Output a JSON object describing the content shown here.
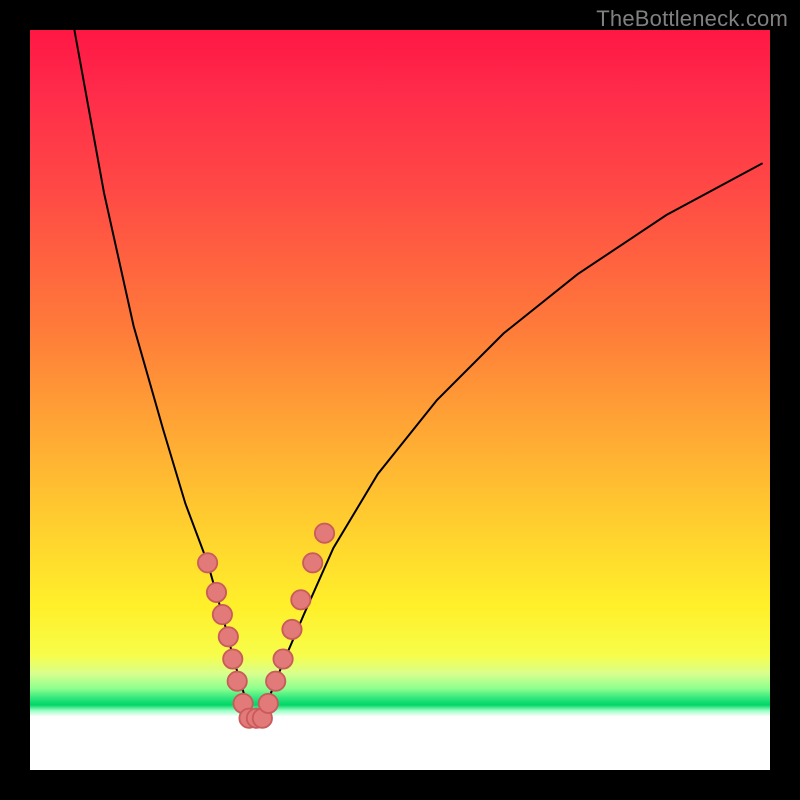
{
  "watermark": "TheBottleneck.com",
  "colors": {
    "gradient_top": "#ff1744",
    "gradient_mid1": "#ff7a3a",
    "gradient_mid2": "#ffd22e",
    "gradient_green": "#00d664",
    "gradient_bottom": "#ffffff",
    "curve_stroke": "#000000",
    "marker_fill": "#e27a7a",
    "marker_stroke": "#c95b5b",
    "frame": "#000000"
  },
  "chart_data": {
    "type": "line",
    "title": "",
    "xlabel": "",
    "ylabel": "",
    "xlim": [
      0,
      100
    ],
    "ylim": [
      0,
      100
    ],
    "note": "No axis ticks, labels, or grid shown. Values describe the V-shaped curve on a 0–100 abstract scale (0 at top, 100 at bottom is inverted for plotting).",
    "series": [
      {
        "name": "bottleneck-curve",
        "x": [
          6,
          10,
          14,
          18,
          21,
          24,
          26,
          27.5,
          29,
          30.5,
          32,
          34,
          37,
          41,
          47,
          55,
          64,
          74,
          86,
          99
        ],
        "y": [
          0,
          22,
          40,
          54,
          64,
          72,
          79,
          85,
          90,
          93,
          91,
          86,
          79,
          70,
          60,
          50,
          41,
          33,
          25,
          18
        ]
      }
    ],
    "markers": {
      "name": "data-points",
      "note": "Salmon circular markers clustered on both arms of the V between roughly y=70 and y=95 (lower portion of chart).",
      "points": [
        {
          "x": 24.0,
          "y": 72
        },
        {
          "x": 25.2,
          "y": 76
        },
        {
          "x": 26.0,
          "y": 79
        },
        {
          "x": 26.8,
          "y": 82
        },
        {
          "x": 27.4,
          "y": 85
        },
        {
          "x": 28.0,
          "y": 88
        },
        {
          "x": 28.8,
          "y": 91
        },
        {
          "x": 29.6,
          "y": 93
        },
        {
          "x": 30.6,
          "y": 93
        },
        {
          "x": 31.4,
          "y": 93
        },
        {
          "x": 32.2,
          "y": 91
        },
        {
          "x": 33.2,
          "y": 88
        },
        {
          "x": 34.2,
          "y": 85
        },
        {
          "x": 35.4,
          "y": 81
        },
        {
          "x": 36.6,
          "y": 77
        },
        {
          "x": 38.2,
          "y": 72
        },
        {
          "x": 39.8,
          "y": 68
        }
      ]
    }
  }
}
